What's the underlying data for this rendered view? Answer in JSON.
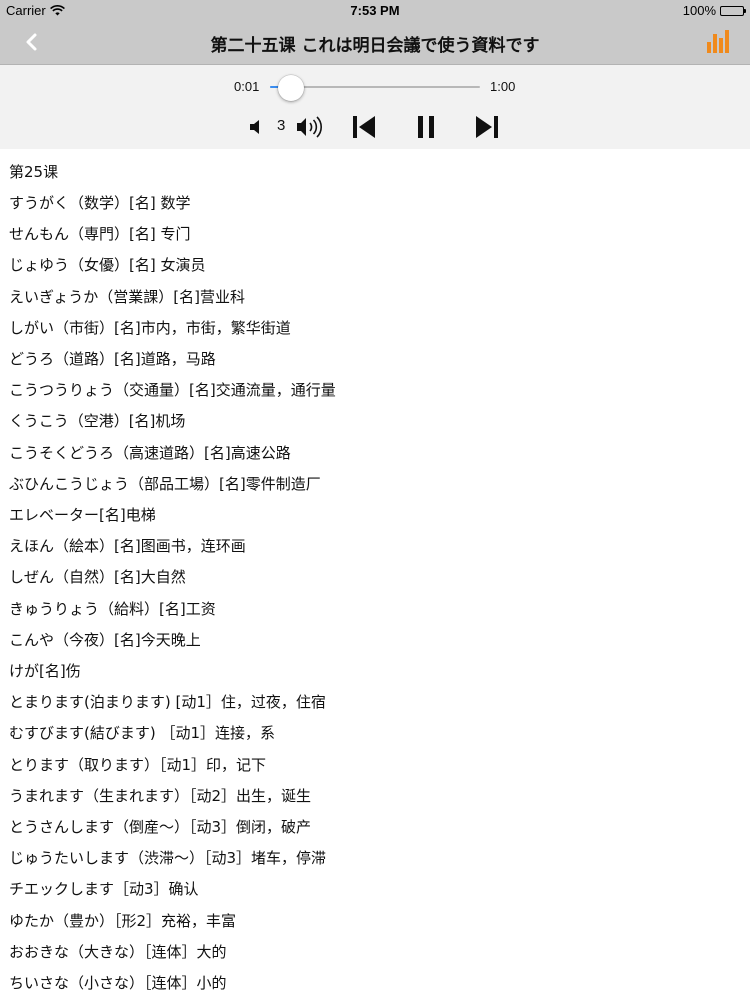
{
  "status_bar": {
    "carrier": "Carrier",
    "time": "7:53 PM",
    "battery": "100%"
  },
  "nav": {
    "title": "第二十五课 これは明日会議で使う資料です",
    "back_icon": "chevron-left-icon",
    "right_icon": "equalizer-icon",
    "accent_color": "#f08a1c"
  },
  "player": {
    "elapsed": "0:01",
    "duration": "1:00",
    "progress": 0.017,
    "volume_level": "3",
    "slider_color": "#3a8df0"
  },
  "lesson": {
    "lines": [
      "第25课",
      "すうがく（数学）[名] 数学",
      "せんもん（専門）[名] 专门",
      "じょゆう（女優）[名] 女演员",
      "えいぎょうか（営業課）[名]营业科",
      "しがい（市街）[名]市内，市街，繁华街道",
      "どうろ（道路）[名]道路，马路",
      "こうつうりょう（交通量）[名]交通流量，通行量",
      "くうこう（空港）[名]机场",
      "こうそくどうろ（高速道路）[名]高速公路",
      "ぶひんこうじょう（部品工場）[名]零件制造厂",
      "エレベーター[名]电梯",
      "えほん（絵本）[名]图画书，连环画",
      "しぜん（自然）[名]大自然",
      "きゅうりょう（給料）[名]工资",
      "こんや（今夜）[名]今天晚上",
      "けが[名]伤",
      "とまります(泊まります) [动1］住，过夜，住宿",
      "むすびます(結びます) ［动1］连接，系",
      "とります（取ります）［动1］印，记下",
      "うまれます（生まれます）［动2］出生，诞生",
      "とうさんします（倒産～）［动3］倒闭，破产",
      "じゅうたいします（渋滞～）［动3］堵车，停滞",
      "チエックします［动3］确认",
      "ゆたか（豊か）［形2］充裕，丰富",
      "おおきな（大きな）［连体］大的",
      "ちいさな（小さな）［连体］小的"
    ]
  }
}
